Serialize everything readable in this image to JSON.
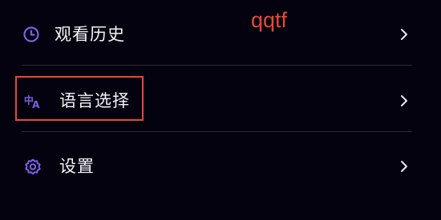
{
  "menu": {
    "items": [
      {
        "label": "观看历史",
        "icon": "clock-icon"
      },
      {
        "label": "语言选择",
        "icon": "translate-icon"
      },
      {
        "label": "设置",
        "icon": "gear-icon"
      }
    ]
  },
  "annotation": {
    "text": "qqtf",
    "color": "#e4473a"
  },
  "colors": {
    "background": "#05020f",
    "accent": "#7a63e6",
    "highlight": "#e4473a"
  }
}
